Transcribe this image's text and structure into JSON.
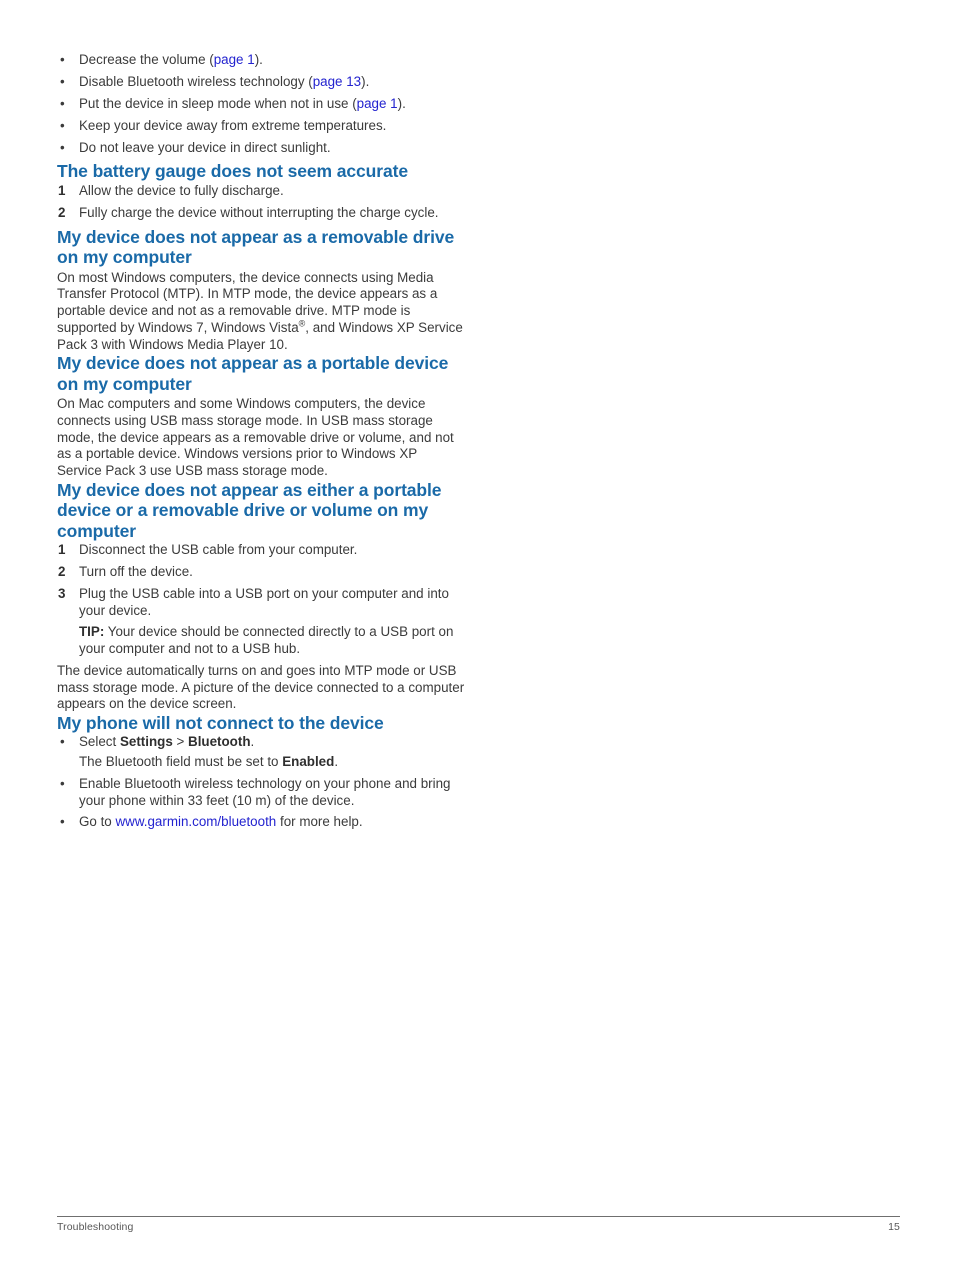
{
  "document": {
    "footer": {
      "chapter": "Troubleshooting",
      "page_number": "15"
    },
    "colors": {
      "heading_blue": "#1a6aa8",
      "link_blue": "#2323cf",
      "body_text": "#3b3b3b"
    }
  },
  "intro_bullets": {
    "items": [
      {
        "pre": "Decrease the volume (",
        "link": "page 1",
        "post": ")."
      },
      {
        "pre": "Disable Bluetooth wireless technology (",
        "link": "page 13",
        "post": ")."
      },
      {
        "pre": "Put the device in sleep mode when not in use (",
        "link": "page 1",
        "post": ")."
      },
      {
        "pre": "Keep your device away from extreme temperatures.",
        "link": "",
        "post": ""
      },
      {
        "pre": "Do not leave your device in direct sunlight.",
        "link": "",
        "post": ""
      }
    ],
    "bullet_glyph": "•"
  },
  "section_battery": {
    "heading": "The battery gauge does not seem accurate",
    "steps": [
      {
        "num": "1",
        "text": "Allow the device to fully discharge."
      },
      {
        "num": "2",
        "text": "Fully charge the device without interrupting the charge cycle."
      }
    ]
  },
  "section_removable_drive": {
    "heading": "My device does not appear as a removable drive on my computer",
    "body_part1": "On most Windows computers, the device connects using Media Transfer Protocol (MTP). In MTP mode, the device appears as a portable device and not as a removable drive. MTP mode is supported by Windows 7, Windows Vista",
    "registered_mark": "®",
    "body_part2": ", and Windows XP Service Pack 3 with Windows Media Player 10."
  },
  "section_portable_device": {
    "heading": "My device does not appear as a portable device on my computer",
    "body": "On Mac computers and some Windows computers, the device connects using USB mass storage mode. In USB mass storage mode, the device appears as a removable drive or volume, and not as a portable device. Windows versions prior to Windows XP Service Pack 3 use USB mass storage mode."
  },
  "section_either": {
    "heading": "My device does not appear as either a portable device or a removable drive or volume on my computer",
    "steps": [
      {
        "num": "1",
        "text": "Disconnect the USB cable from your computer."
      },
      {
        "num": "2",
        "text": "Turn off the device."
      },
      {
        "num": "3",
        "text": "Plug the USB cable into a USB port on your computer and into your device."
      }
    ],
    "tip_label": "TIP:",
    "tip_text": " Your device should be connected directly to a USB port on your computer and not to a USB hub.",
    "closing_paragraph": "The device automatically turns on and goes into MTP mode or USB mass storage mode. A picture of the device connected to a computer appears on the device screen."
  },
  "section_phone": {
    "heading": "My phone will not connect to the device",
    "bullet1": {
      "pre": "Select ",
      "bold1": "Settings",
      "mid": " > ",
      "bold2": "Bluetooth",
      "post": ".",
      "sub_pre": "The Bluetooth field must be set to ",
      "sub_bold": "Enabled",
      "sub_post": "."
    },
    "bullet2": "Enable Bluetooth wireless technology on your phone and bring your phone within 33 feet (10 m) of the device.",
    "bullet3": {
      "pre": "Go to ",
      "link": "www.garmin.com/bluetooth",
      "post": " for more help."
    }
  }
}
